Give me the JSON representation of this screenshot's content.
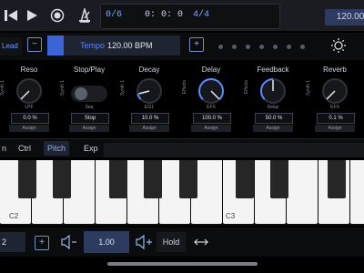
{
  "transport": {
    "position": "0/6",
    "time": "0: 0: 0",
    "signature": "4/4",
    "tempo": "120.00"
  },
  "preset": {
    "lead_label": "Lead",
    "tempo_label": "Tempo",
    "tempo_value": "120.00 BPM",
    "minus": "−",
    "plus": "+"
  },
  "knobs": [
    {
      "name": "Reso",
      "side": "Synth 1",
      "sub": "LPF",
      "value": "0.0 %",
      "assign": "Assign",
      "level": 0.0
    },
    {
      "name": "Stop/Play",
      "side": "Synth 1",
      "sub": "Seq",
      "value": "Stop",
      "assign": "Assign",
      "level": 0
    },
    {
      "name": "Decay",
      "side": "Synth 1",
      "sub": "EG1",
      "value": "10.0 %",
      "assign": "Assign",
      "level": 0.1
    },
    {
      "name": "Delay",
      "side": "Effects",
      "sub": "EFX",
      "value": "100.0 %",
      "assign": "Assign",
      "level": 1.0
    },
    {
      "name": "Feedback",
      "side": "Effects",
      "sub": "Delay",
      "value": "50.0 %",
      "assign": "Assign",
      "level": 0.5
    },
    {
      "name": "Reverb",
      "side": "Synth 1",
      "sub": "EFX",
      "value": "0.1 %",
      "assign": "Assign",
      "level": 0.001
    }
  ],
  "tabs": [
    "n",
    "Ctrl",
    "Pitch",
    "Exp"
  ],
  "keyboard": {
    "c2": "C2",
    "c3": "C3"
  },
  "bottom": {
    "octave": "2",
    "velocity": "1.00",
    "hold": "Hold"
  },
  "colors": {
    "accent": "#3a64d8",
    "knob_arc": "#5d88ff",
    "panel": "#1a1c21"
  }
}
